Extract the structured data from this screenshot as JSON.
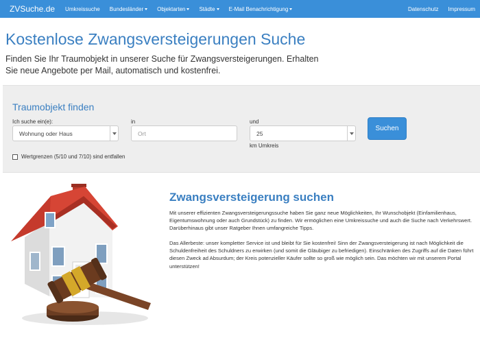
{
  "nav": {
    "brand": "ZVSuche.de",
    "items": [
      {
        "label": "Umkreissuche",
        "dropdown": false
      },
      {
        "label": "Bundesländer",
        "dropdown": true
      },
      {
        "label": "Objektarten",
        "dropdown": true
      },
      {
        "label": "Städte",
        "dropdown": true
      },
      {
        "label": "E-Mail Benachrichtigung",
        "dropdown": true
      }
    ],
    "right_items": [
      {
        "label": "Datenschutz"
      },
      {
        "label": "Impressum"
      }
    ]
  },
  "hero": {
    "title": "Kostenlose Zwangsversteigerungen Suche",
    "lead": "Finden Sie Ihr Traumobjekt in unserer Suche für Zwangsversteigerungen. Erhalten Sie neue Angebote per Mail, automatisch und kostenfrei."
  },
  "search": {
    "title": "Traumobjekt finden",
    "type_label": "Ich suche ein(e):",
    "type_value": "Wohnung oder Haus",
    "location_label": "in",
    "location_placeholder": "Ort",
    "radius_label": "und",
    "radius_value": "25",
    "radius_unit": "km Umkreis",
    "button_label": "Suchen",
    "checkbox_label": "Wertgrenzen (5/10 und 7/10) sind entfallen"
  },
  "content": {
    "title": "Zwangsversteigerung suchen",
    "paragraph_1": "Mit unserer effizienten Zwangsversteigerungssuche haben Sie ganz neue Möglichkeiten, Ihr Wunschobjekt (Einfamilienhaus, Eigentumswohnung oder auch Grundstück) zu finden. Wir ermöglichen eine Umkreissuche und auch die Suche nach Verkehrswert. Darüberhinaus gibt unser Ratgeber Ihnen umfangreiche Tipps.",
    "paragraph_2": "Das Allerbeste: unser kompletter Service ist und bleibt für Sie kostenfrei! Sinn der Zwangsversteigerung ist nach Möglichkeit die Schuldenfreiheit des Schuldners zu erwirken (und somit die Gläubiger zu befriedigen). Einschränken des Zugriffs auf die Daten führt diesen Zweck ad Absurdum; der Kreis potenzieller Käufer sollte so groß wie möglich sein. Das möchten wir mit unserem Portal unterstützen!"
  },
  "colors": {
    "navbar": "#3a8fd9",
    "heading": "#3a7fc1",
    "panel": "#eeeeee",
    "button": "#3a8fd9"
  },
  "icons": {
    "dropdown": "caret-down-icon",
    "image": "house-with-gavel-illustration"
  }
}
